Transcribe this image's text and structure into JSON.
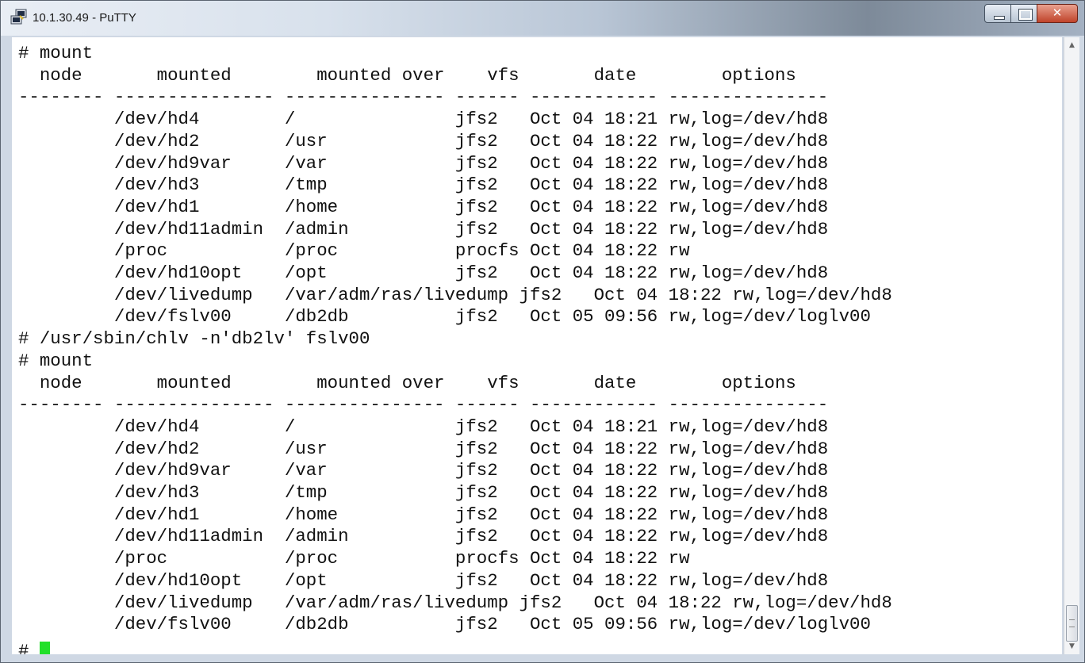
{
  "window": {
    "title": "10.1.30.49 - PuTTY",
    "icon": "putty-terminal-icon"
  },
  "terminal": {
    "prompt": "#",
    "lines": [
      "# mount",
      "  node       mounted        mounted over    vfs       date        options",
      "-------- --------------- --------------- ------ ------------ ---------------",
      "         /dev/hd4        /               jfs2   Oct 04 18:21 rw,log=/dev/hd8",
      "         /dev/hd2        /usr            jfs2   Oct 04 18:22 rw,log=/dev/hd8",
      "         /dev/hd9var     /var            jfs2   Oct 04 18:22 rw,log=/dev/hd8",
      "         /dev/hd3        /tmp            jfs2   Oct 04 18:22 rw,log=/dev/hd8",
      "         /dev/hd1        /home           jfs2   Oct 04 18:22 rw,log=/dev/hd8",
      "         /dev/hd11admin  /admin          jfs2   Oct 04 18:22 rw,log=/dev/hd8",
      "         /proc           /proc           procfs Oct 04 18:22 rw",
      "         /dev/hd10opt    /opt            jfs2   Oct 04 18:22 rw,log=/dev/hd8",
      "         /dev/livedump   /var/adm/ras/livedump jfs2   Oct 04 18:22 rw,log=/dev/hd8",
      "         /dev/fslv00     /db2db          jfs2   Oct 05 09:56 rw,log=/dev/loglv00",
      "# /usr/sbin/chlv -n'db2lv' fslv00",
      "# mount",
      "  node       mounted        mounted over    vfs       date        options",
      "-------- --------------- --------------- ------ ------------ ---------------",
      "         /dev/hd4        /               jfs2   Oct 04 18:21 rw,log=/dev/hd8",
      "         /dev/hd2        /usr            jfs2   Oct 04 18:22 rw,log=/dev/hd8",
      "         /dev/hd9var     /var            jfs2   Oct 04 18:22 rw,log=/dev/hd8",
      "         /dev/hd3        /tmp            jfs2   Oct 04 18:22 rw,log=/dev/hd8",
      "         /dev/hd1        /home           jfs2   Oct 04 18:22 rw,log=/dev/hd8",
      "         /dev/hd11admin  /admin          jfs2   Oct 04 18:22 rw,log=/dev/hd8",
      "         /proc           /proc           procfs Oct 04 18:22 rw",
      "         /dev/hd10opt    /opt            jfs2   Oct 04 18:22 rw,log=/dev/hd8",
      "         /dev/livedump   /var/adm/ras/livedump jfs2   Oct 04 18:22 rw,log=/dev/hd8",
      "         /dev/fslv00     /db2db          jfs2   Oct 05 09:56 rw,log=/dev/loglv00"
    ]
  },
  "colors": {
    "cursor": "#22e02a",
    "terminal_bg": "#ffffff",
    "terminal_fg": "#111111"
  },
  "icons": {
    "minimize": "minimize-icon",
    "maximize": "maximize-icon",
    "close": "close-icon",
    "scroll_up": "scroll-up-arrow-icon",
    "scroll_down": "scroll-down-arrow-icon"
  }
}
